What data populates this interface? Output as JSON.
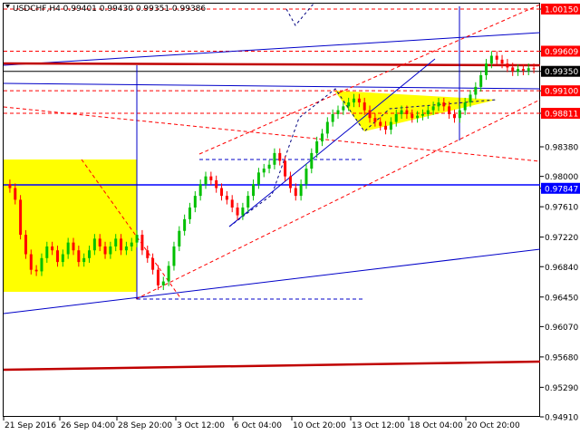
{
  "header": {
    "symbol_line": "USDCHF,H4  0.99401 0.99430 0.99351 0.99386"
  },
  "colors": {
    "up": "#00c000",
    "down": "#ff0000",
    "highlight_box": "#ffff00",
    "axis_label_bg": "#0000ff",
    "red_label_bg": "#ff0000",
    "resistance_line": "#c00000"
  },
  "chart_data": {
    "type": "candlestick",
    "title": "",
    "symbol": "USDCHF",
    "timeframe": "H4",
    "ylim": [
      0.9491,
      1.0022
    ],
    "y_ticks": [
      1.0015,
      0.99609,
      0.9935,
      0.991,
      0.98811,
      0.9838,
      0.98,
      0.97847,
      0.9761,
      0.9722,
      0.9684,
      0.9645,
      0.9607,
      0.9568,
      0.9529,
      0.9491
    ],
    "y_tick_labels": [
      "1.00150",
      "0.99609",
      "0.99350",
      "0.99100",
      "0.98811",
      "0.98380",
      "0.98000",
      "0.97847",
      "0.97610",
      "0.97220",
      "0.96840",
      "0.96450",
      "0.96070",
      "0.95680",
      "0.95290",
      "0.94910"
    ],
    "highlighted_levels": [
      {
        "value": 1.0015,
        "label": "1.00150",
        "style": "red"
      },
      {
        "value": 0.99609,
        "label": "0.99609",
        "style": "red"
      },
      {
        "value": 0.9935,
        "label": "0.99350",
        "style": "black"
      },
      {
        "value": 0.991,
        "label": "0.99100",
        "style": "red"
      },
      {
        "value": 0.98811,
        "label": "0.98811",
        "style": "red"
      },
      {
        "value": 0.97847,
        "label": "0.97847",
        "style": "blue"
      }
    ],
    "x_labels": [
      "21 Sep 2016",
      "26 Sep 04:00",
      "28 Sep 20:00",
      "3 Oct 12:00",
      "6 Oct 04:00",
      "10 Oct 20:00",
      "13 Oct 12:00",
      "18 Oct 04:00",
      "20 Oct 20:00"
    ],
    "close_series": [
      0.9785,
      0.977,
      0.9725,
      0.97,
      0.968,
      0.9678,
      0.9695,
      0.971,
      0.9705,
      0.969,
      0.97,
      0.9715,
      0.9705,
      0.969,
      0.9695,
      0.9705,
      0.972,
      0.971,
      0.97,
      0.971,
      0.972,
      0.9705,
      0.971,
      0.9715,
      0.9725,
      0.9705,
      0.9695,
      0.968,
      0.966,
      0.9665,
      0.9685,
      0.971,
      0.973,
      0.9745,
      0.976,
      0.9775,
      0.979,
      0.98,
      0.9795,
      0.9785,
      0.9775,
      0.977,
      0.976,
      0.975,
      0.976,
      0.9775,
      0.979,
      0.9805,
      0.981,
      0.9815,
      0.983,
      0.982,
      0.98,
      0.9785,
      0.9775,
      0.979,
      0.981,
      0.983,
      0.9845,
      0.9855,
      0.987,
      0.988,
      0.9885,
      0.989,
      0.9895,
      0.99,
      0.9895,
      0.9885,
      0.9875,
      0.987,
      0.9865,
      0.986,
      0.987,
      0.988,
      0.9885,
      0.988,
      0.9875,
      0.9878,
      0.988,
      0.9885,
      0.989,
      0.9895,
      0.989,
      0.988,
      0.9875,
      0.9885,
      0.9895,
      0.9905,
      0.9915,
      0.993,
      0.9945,
      0.9955,
      0.995,
      0.9945,
      0.994,
      0.9935,
      0.9938,
      0.9936,
      0.9939,
      0.99386
    ]
  }
}
